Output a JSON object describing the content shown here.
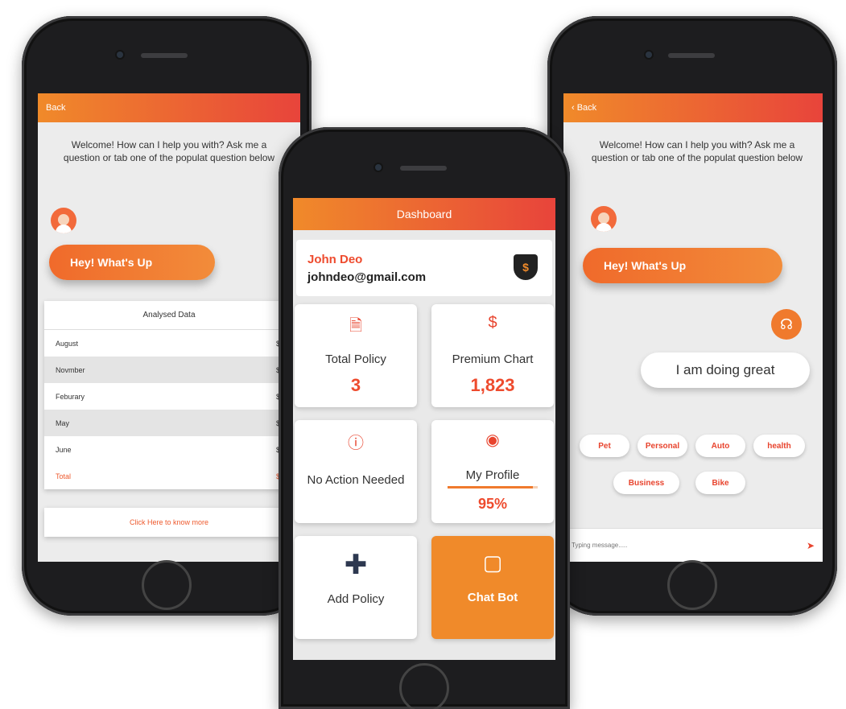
{
  "left": {
    "back_label": "Back",
    "welcome": "Welcome! How can I help you with? Ask me a question or tab one of the populat question below",
    "bubble": "Hey! What's Up",
    "table_title": "Analysed Data",
    "rows": [
      {
        "label": "August",
        "value": "$0"
      },
      {
        "label": "Novmber",
        "value": "$0"
      },
      {
        "label": "Feburary",
        "value": "$0"
      },
      {
        "label": "May",
        "value": "$0"
      },
      {
        "label": "June",
        "value": "$0"
      }
    ],
    "total": {
      "label": "Total",
      "value": "$0"
    },
    "cta": "Click Here to know more"
  },
  "center": {
    "title": "Dashboard",
    "name": "John Deo",
    "email": "johndeo@gmail.com",
    "tiles": {
      "total_policy": {
        "label": "Total Policy",
        "value": "3"
      },
      "premium_chart": {
        "label": "Premium Chart",
        "value": "1,823"
      },
      "no_action": {
        "label": "No Action Needed"
      },
      "my_profile": {
        "label": "My Profile",
        "value": "95%",
        "progress": 0.95
      },
      "add_policy": {
        "label": "Add Policy"
      },
      "chat_bot": {
        "label": "Chat Bot"
      }
    }
  },
  "right": {
    "back_label": "‹ Back",
    "welcome": "Welcome! How can I help you with? Ask me a question or tab one of the populat question below",
    "bubble": "Hey! What's Up",
    "reply": "I am doing great",
    "chips": [
      "Pet",
      "Personal",
      "Auto",
      "health",
      "Business",
      "Bike"
    ],
    "input_placeholder": "Typing message....."
  },
  "colors": {
    "accent": "#f08a2a",
    "accent_red": "#e8443b"
  }
}
